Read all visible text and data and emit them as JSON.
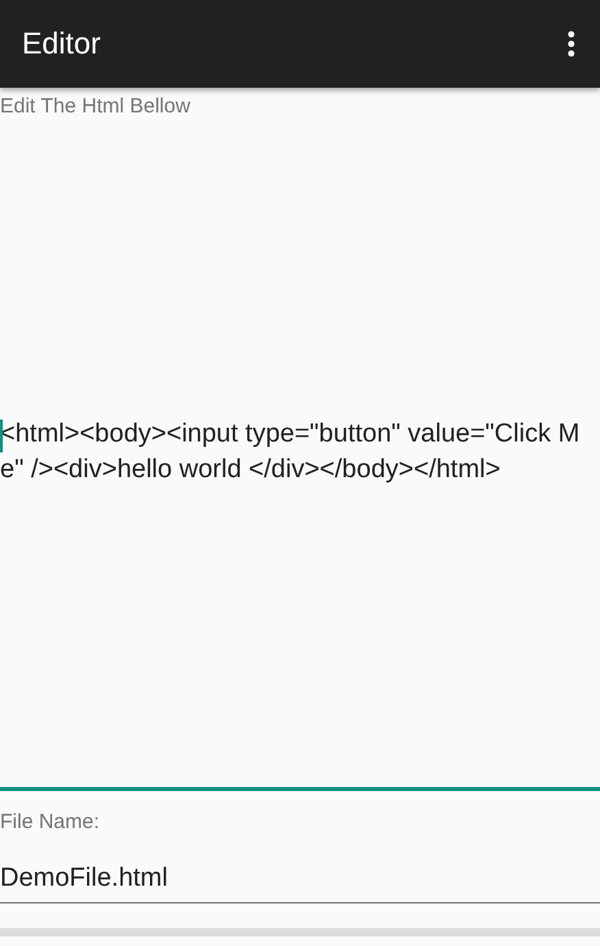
{
  "app_bar": {
    "title": "Editor"
  },
  "editor": {
    "label": "Edit The Html Bellow",
    "value": "<html><body><input type=\"button\" value=\"Click Me\" /><div>hello world </div></body></html>",
    "focused": true
  },
  "file_name": {
    "label": "File Name:",
    "value": "DemoFile.html",
    "focused": false
  }
}
